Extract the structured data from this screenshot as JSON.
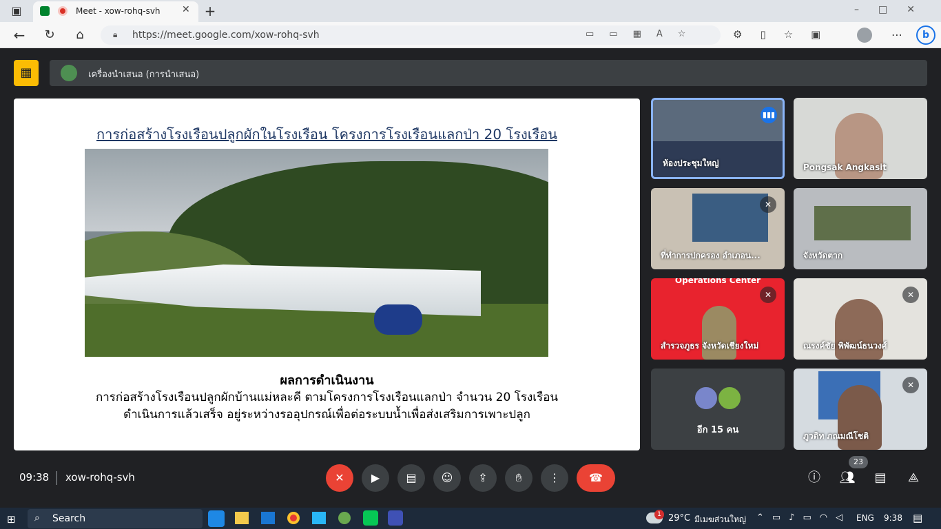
{
  "browser": {
    "tab_title": "Meet - xow-rohq-svh",
    "url": "https://meet.google.com/xow-rohq-svh"
  },
  "presenter_bar": {
    "label": "เครื่องนำเสนอ (การนำเสนอ)"
  },
  "slide": {
    "title": "การก่อสร้างโรงเรือนปลูกผักในโรงเรือน โครงการโรงเรือนแลกป่า 20 โรงเรือน",
    "heading": "ผลการดำเนินงาน",
    "line1": "การก่อสร้างโรงเรือนปลูกผักบ้านแม่หละคี ตามโครงการโรงเรือนแลกป่า  จำนวน 20 โรงเรือน",
    "line2": "ดำเนินการแล้วเสร็จ อยู่ระหว่างรออุปกรณ์เพื่อต่อระบบน้ำเพื่อส่งเสริมการเพาะปลูก"
  },
  "participants": [
    {
      "name": "ห้องประชุมใหญ่",
      "speaking": true
    },
    {
      "name": "Pongsak Angkasit"
    },
    {
      "name": "ที่ทำการปกครอง อำเภอน...",
      "muted": true
    },
    {
      "name": "จังหวัดตาก"
    },
    {
      "name": "สำรวจภูธร จังหวัดเชียงใหม่",
      "muted": true,
      "banner": "Operations Center"
    },
    {
      "name": "ณรงค์ชัย พิพัฒน์ธนวงศ์",
      "muted": true
    },
    {
      "name": "ภูวดิท ภณมณีโชติ",
      "muted": true
    }
  ],
  "others_tile": {
    "label": "อีก 15 คน"
  },
  "footer": {
    "time": "09:38",
    "meeting_code": "xow-rohq-svh",
    "people_count": "23"
  },
  "taskbar": {
    "search": "Search",
    "weather_temp": "29°C",
    "weather_desc": "มีเมฆส่วนใหญ่",
    "weather_badge": "1",
    "lang": "ENG",
    "clock": "9:38"
  },
  "colors": {
    "end_call": "#ea4335",
    "muted_btn": "#ea4335",
    "speaking_border": "#8ab4f8",
    "presenter_icon": "#fbbc04",
    "slide_title": "#1f3864"
  }
}
